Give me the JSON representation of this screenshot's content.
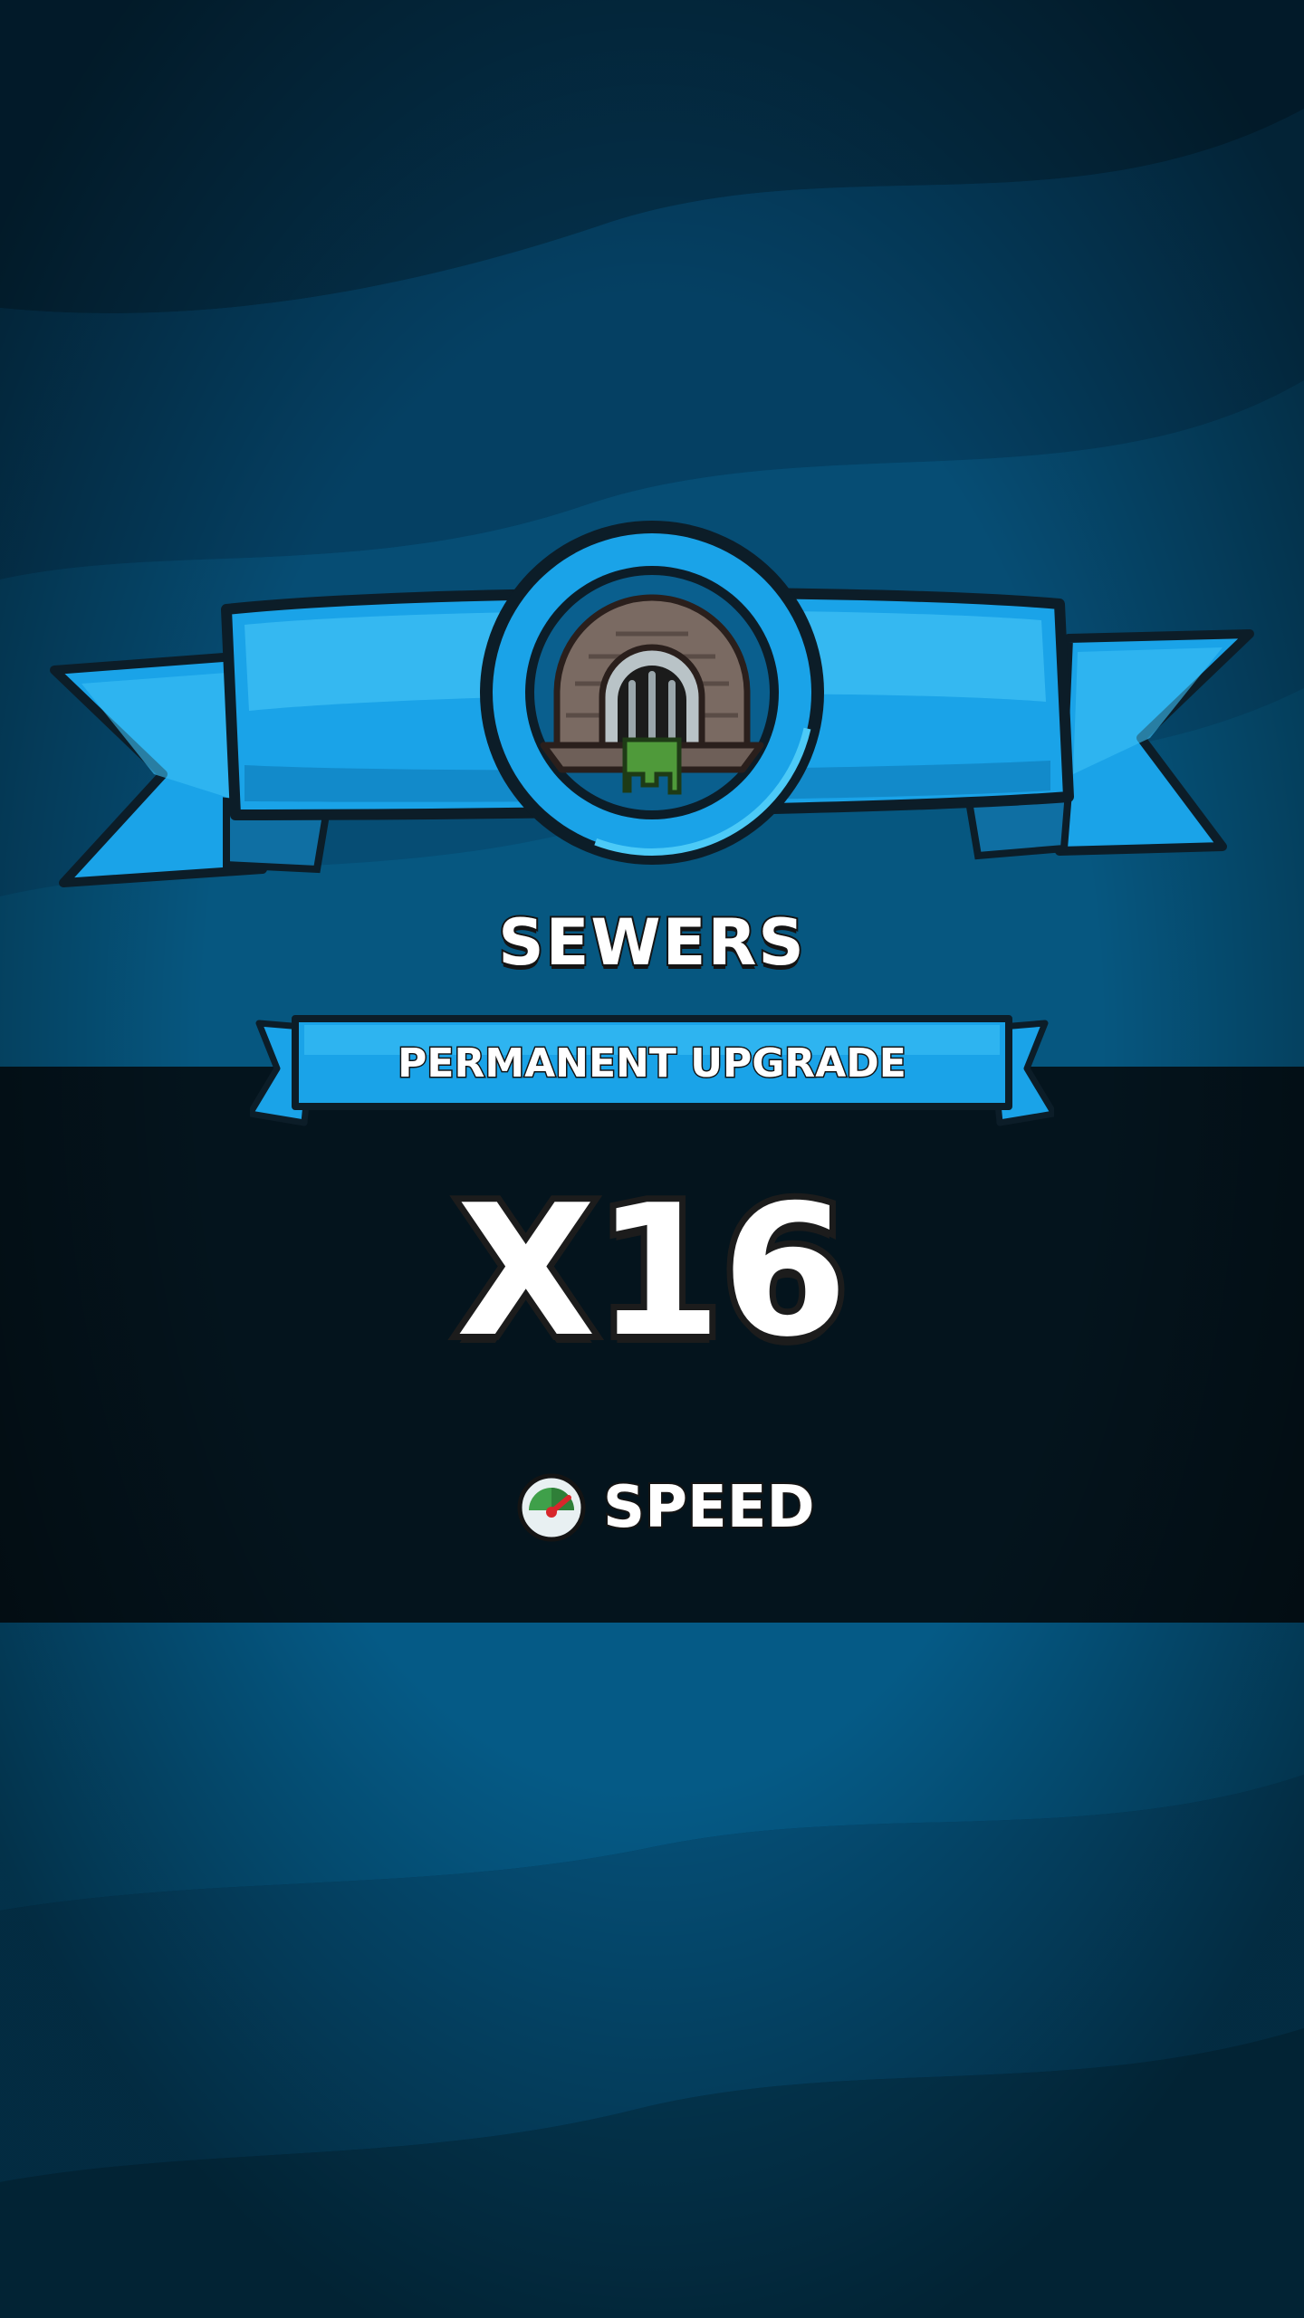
{
  "upgrade": {
    "location_name": "SEWERS",
    "ribbon_label": "PERMANENT UPGRADE",
    "multiplier": "X16",
    "stat_label": "SPEED"
  },
  "icons": {
    "emblem": "sewer-pipe-icon",
    "stat": "speedometer-icon"
  },
  "colors": {
    "background": "#05496e",
    "band": "#04141d",
    "ribbon_blue": "#1aa3e8",
    "ribbon_light": "#3cc0f5",
    "outline": "#141414",
    "text": "#ffffff"
  }
}
